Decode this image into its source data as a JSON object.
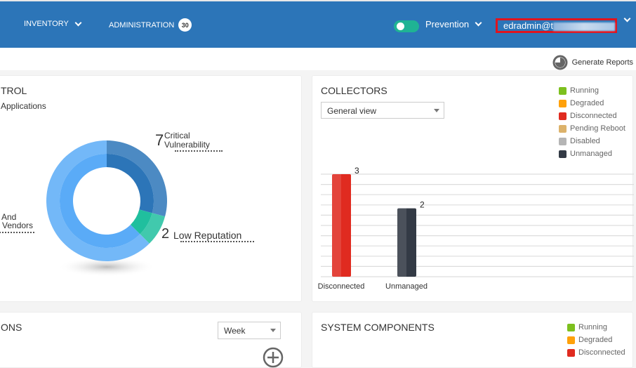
{
  "header": {
    "nav": [
      {
        "label": "INVENTORY"
      },
      {
        "label": "ADMINISTRATION",
        "badge": "30"
      }
    ],
    "mode_toggle": {
      "on": true,
      "color": "#1fb394"
    },
    "mode_label": "Prevention",
    "user": "edradmin@t",
    "brand_color": "#2c75b8"
  },
  "toolbar": {
    "generate_reports": "Generate Reports"
  },
  "app_control": {
    "title_fragment": "TROL",
    "subtitle_fragment": "Applications",
    "labels": {
      "critical_count": "7",
      "critical_line1": "Critical",
      "critical_line2": "Vulnerability",
      "low_count": "2",
      "low_label": "Low Reputation",
      "vendors_line1": "And",
      "vendors_line2": "Vendors"
    }
  },
  "collectors": {
    "title": "COLLECTORS",
    "view_select": "General view",
    "legend": [
      {
        "label": "Running",
        "color": "#7dc01e"
      },
      {
        "label": "Degraded",
        "color": "#ffa10a"
      },
      {
        "label": "Disconnected",
        "color": "#e02b20"
      },
      {
        "label": "Pending Reboot",
        "color": "#dcb26a"
      },
      {
        "label": "Disabled",
        "color": "#b5b5b5"
      },
      {
        "label": "Unmanaged",
        "color": "#333a45"
      }
    ]
  },
  "communications": {
    "title_fragment": "ONS",
    "period_select": "Week"
  },
  "system_components": {
    "title": "SYSTEM COMPONENTS",
    "legend": [
      {
        "label": "Running",
        "color": "#7dc01e"
      },
      {
        "label": "Degraded",
        "color": "#ffa10a"
      },
      {
        "label": "Disconnected",
        "color": "#e02b20"
      }
    ]
  },
  "chart_data": [
    {
      "type": "pie",
      "donut": true,
      "slices": [
        {
          "label": "Critical Vulnerability",
          "value": 7,
          "color": "#2c75b8"
        },
        {
          "label": "Low Reputation",
          "value": 2,
          "color": "#20bf9e"
        },
        {
          "label": "And Vendors",
          "value": 15,
          "color": "#5aabf7"
        }
      ]
    },
    {
      "type": "bar",
      "categories": [
        "Disconnected",
        "Unmanaged"
      ],
      "values": [
        3,
        2
      ],
      "colors": [
        "#e02b20",
        "#333a45"
      ],
      "data_labels": [
        "3",
        "2"
      ],
      "ylim": [
        0,
        3
      ],
      "grid": true
    }
  ]
}
